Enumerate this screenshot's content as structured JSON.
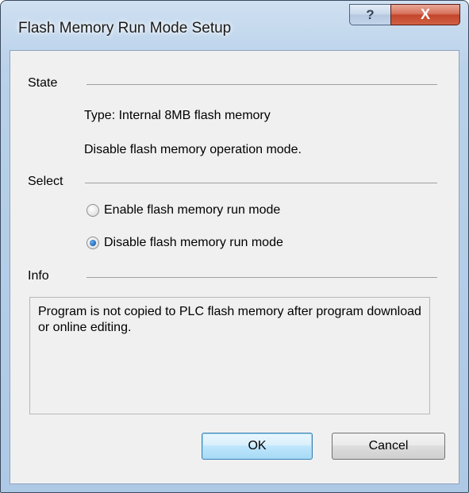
{
  "window": {
    "title": "Flash Memory Run Mode Setup",
    "help_label": "?",
    "close_label": "X"
  },
  "state": {
    "label": "State",
    "type_text": "Type: Internal 8MB flash memory",
    "mode_text": "Disable flash memory operation mode."
  },
  "select": {
    "label": "Select",
    "options": [
      {
        "label": "Enable flash memory run mode",
        "selected": false
      },
      {
        "label": "Disable flash memory run mode",
        "selected": true
      }
    ]
  },
  "info": {
    "label": "Info",
    "text": "Program is not copied to PLC flash memory after program download or online editing."
  },
  "buttons": {
    "ok_label": "OK",
    "cancel_label": "Cancel"
  },
  "colors": {
    "title_frame": "#b9d1ea",
    "client_bg": "#f0f0f0",
    "close_button": "#c3452b",
    "radio_selected": "#2a6fc0"
  }
}
